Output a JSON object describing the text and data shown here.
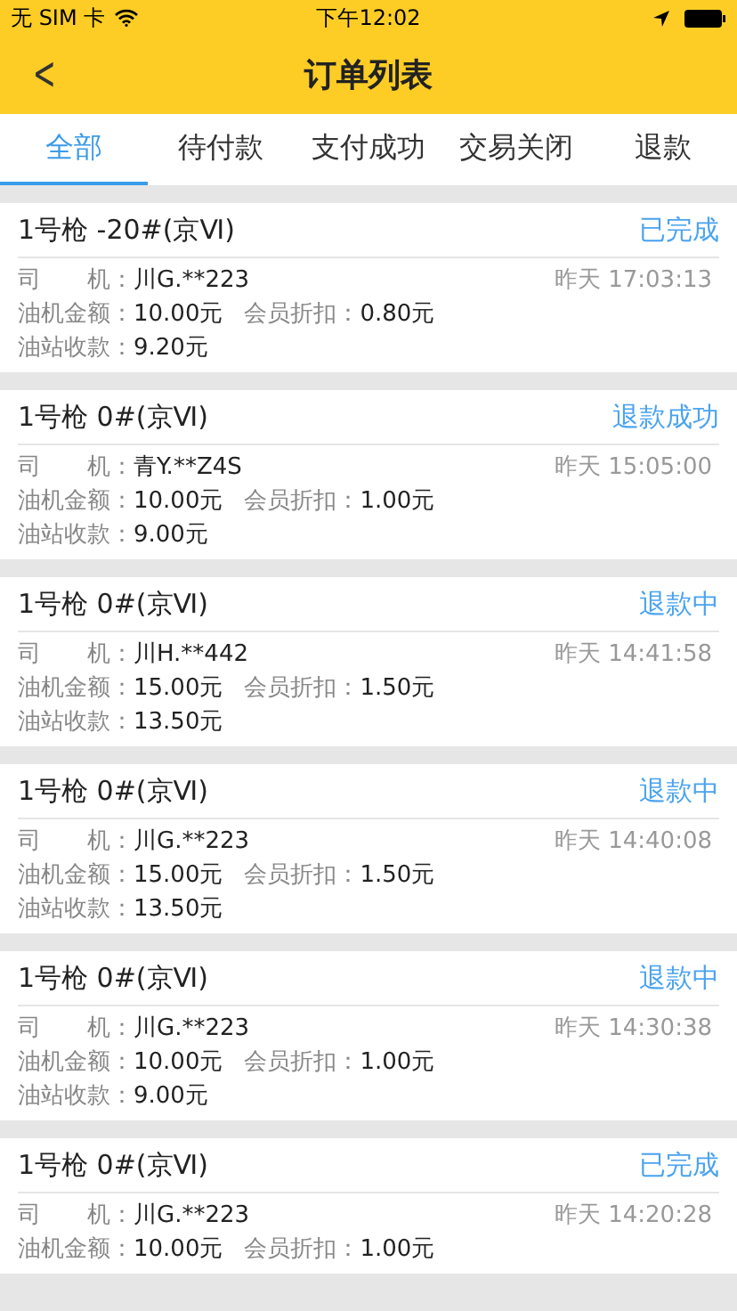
{
  "status_bar": {
    "carrier": "无 SIM 卡",
    "time": "下午12:02"
  },
  "nav": {
    "back": "<",
    "title": "订单列表"
  },
  "tabs": [
    {
      "label": "全部",
      "selected": true
    },
    {
      "label": "待付款",
      "selected": false
    },
    {
      "label": "支付成功",
      "selected": false
    },
    {
      "label": "交易关闭",
      "selected": false
    },
    {
      "label": "退款",
      "selected": false
    }
  ],
  "orders": [
    {
      "title": "1号枪 -20#(京Ⅵ)",
      "status": "已完成",
      "driver_label": "司　　机：",
      "driver": "川G.**223",
      "time": "昨天 17:03:13",
      "amount_label": "油机金额：",
      "amount": "10.00元",
      "discount_label": "会员折扣：",
      "discount": "0.80元",
      "received_label": "油站收款：",
      "received": "9.20元"
    },
    {
      "title": "1号枪 0#(京Ⅵ)",
      "status": "退款成功",
      "driver_label": "司　　机：",
      "driver": "青Y.**Z4S",
      "time": "昨天 15:05:00",
      "amount_label": "油机金额：",
      "amount": "10.00元",
      "discount_label": "会员折扣：",
      "discount": "1.00元",
      "received_label": "油站收款：",
      "received": "9.00元"
    },
    {
      "title": "1号枪 0#(京Ⅵ)",
      "status": "退款中",
      "driver_label": "司　　机：",
      "driver": "川H.**442",
      "time": "昨天 14:41:58",
      "amount_label": "油机金额：",
      "amount": "15.00元",
      "discount_label": "会员折扣：",
      "discount": "1.50元",
      "received_label": "油站收款：",
      "received": "13.50元"
    },
    {
      "title": "1号枪 0#(京Ⅵ)",
      "status": "退款中",
      "driver_label": "司　　机：",
      "driver": "川G.**223",
      "time": "昨天 14:40:08",
      "amount_label": "油机金额：",
      "amount": "15.00元",
      "discount_label": "会员折扣：",
      "discount": "1.50元",
      "received_label": "油站收款：",
      "received": "13.50元"
    },
    {
      "title": "1号枪 0#(京Ⅵ)",
      "status": "退款中",
      "driver_label": "司　　机：",
      "driver": "川G.**223",
      "time": "昨天 14:30:38",
      "amount_label": "油机金额：",
      "amount": "10.00元",
      "discount_label": "会员折扣：",
      "discount": "1.00元",
      "received_label": "油站收款：",
      "received": "9.00元"
    },
    {
      "title": "1号枪 0#(京Ⅵ)",
      "status": "已完成",
      "driver_label": "司　　机：",
      "driver": "川G.**223",
      "time": "昨天 14:20:28",
      "amount_label": "油机金额：",
      "amount": "10.00元",
      "discount_label": "会员折扣：",
      "discount": "1.00元"
    }
  ]
}
